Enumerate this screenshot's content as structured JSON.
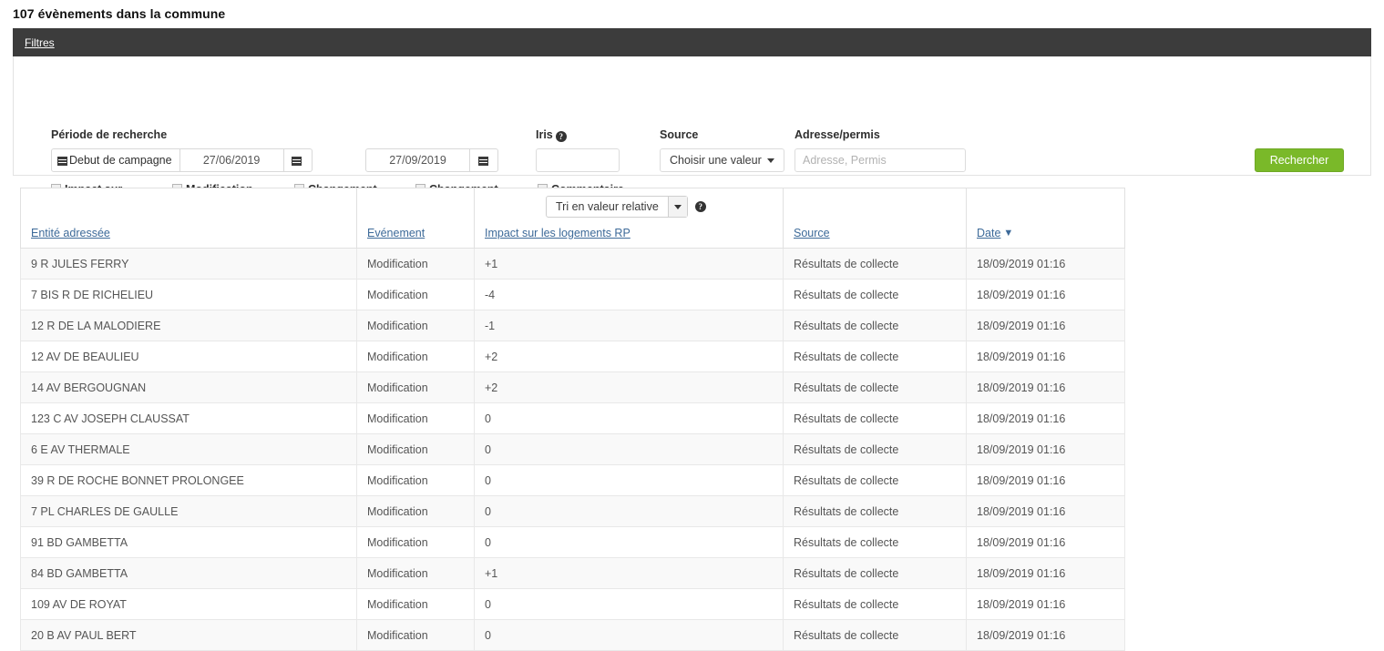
{
  "page": {
    "title": "107 évènements dans la commune"
  },
  "filters": {
    "header_link": "Filtres",
    "period": {
      "label": "Période de recherche",
      "campaign_button": "Debut de campagne",
      "date_from": "27/06/2019",
      "date_to": "27/09/2019",
      "calendar_icon": "calendar-icon"
    },
    "checkboxes": [
      {
        "label": "Impact sur les logements RP",
        "checked": false,
        "has_help": true
      },
      {
        "label": "Modification de l'actualité",
        "checked": false,
        "has_help": true
      },
      {
        "label": "Changement d'iris/îlot",
        "checked": false,
        "has_help": false
      },
      {
        "label": "Changement de catégorie",
        "checked": false,
        "has_help": false
      },
      {
        "label": "Commentaire uniquement",
        "checked": false,
        "has_help": false
      }
    ],
    "iris": {
      "label": "Iris",
      "value": "",
      "has_help": true
    },
    "source": {
      "label": "Source",
      "selected": "Choisir une valeur"
    },
    "address": {
      "label": "Adresse/permis",
      "value": "",
      "placeholder": "Adresse, Permis"
    },
    "search_button": "Rechercher",
    "accent_green": "#7ab929",
    "header_bar_color": "#3c3c3c"
  },
  "table": {
    "columns": [
      {
        "label": "Entité adressée",
        "sortable": true,
        "sorted": false
      },
      {
        "label": "Evénement",
        "sortable": true,
        "sorted": false
      },
      {
        "label": "Impact sur les logements RP",
        "sortable": true,
        "sorted": false,
        "has_help": true,
        "sort_select": "Tri en valeur relative"
      },
      {
        "label": "Source",
        "sortable": true,
        "sorted": false
      },
      {
        "label": "Date",
        "sortable": true,
        "sorted": true,
        "sort_direction": "desc"
      }
    ],
    "rows": [
      {
        "entite": "9 R JULES FERRY",
        "evenement": "Modification",
        "impact": "+1",
        "source": "Résultats de collecte",
        "date": "18/09/2019 01:16"
      },
      {
        "entite": "7 BIS R DE RICHELIEU",
        "evenement": "Modification",
        "impact": "-4",
        "source": "Résultats de collecte",
        "date": "18/09/2019 01:16"
      },
      {
        "entite": "12 R DE LA MALODIERE",
        "evenement": "Modification",
        "impact": "-1",
        "source": "Résultats de collecte",
        "date": "18/09/2019 01:16"
      },
      {
        "entite": "12 AV DE BEAULIEU",
        "evenement": "Modification",
        "impact": "+2",
        "source": "Résultats de collecte",
        "date": "18/09/2019 01:16"
      },
      {
        "entite": "14 AV BERGOUGNAN",
        "evenement": "Modification",
        "impact": "+2",
        "source": "Résultats de collecte",
        "date": "18/09/2019 01:16"
      },
      {
        "entite": "123 C AV JOSEPH CLAUSSAT",
        "evenement": "Modification",
        "impact": "0",
        "source": "Résultats de collecte",
        "date": "18/09/2019 01:16"
      },
      {
        "entite": "6 E AV THERMALE",
        "evenement": "Modification",
        "impact": "0",
        "source": "Résultats de collecte",
        "date": "18/09/2019 01:16"
      },
      {
        "entite": "39 R DE ROCHE BONNET PROLONGEE",
        "evenement": "Modification",
        "impact": "0",
        "source": "Résultats de collecte",
        "date": "18/09/2019 01:16"
      },
      {
        "entite": "7 PL CHARLES DE GAULLE",
        "evenement": "Modification",
        "impact": "0",
        "source": "Résultats de collecte",
        "date": "18/09/2019 01:16"
      },
      {
        "entite": "91 BD GAMBETTA",
        "evenement": "Modification",
        "impact": "0",
        "source": "Résultats de collecte",
        "date": "18/09/2019 01:16"
      },
      {
        "entite": "84 BD GAMBETTA",
        "evenement": "Modification",
        "impact": "+1",
        "source": "Résultats de collecte",
        "date": "18/09/2019 01:16"
      },
      {
        "entite": "109 AV DE ROYAT",
        "evenement": "Modification",
        "impact": "0",
        "source": "Résultats de collecte",
        "date": "18/09/2019 01:16"
      },
      {
        "entite": "20 B AV PAUL BERT",
        "evenement": "Modification",
        "impact": "0",
        "source": "Résultats de collecte",
        "date": "18/09/2019 01:16"
      }
    ]
  }
}
